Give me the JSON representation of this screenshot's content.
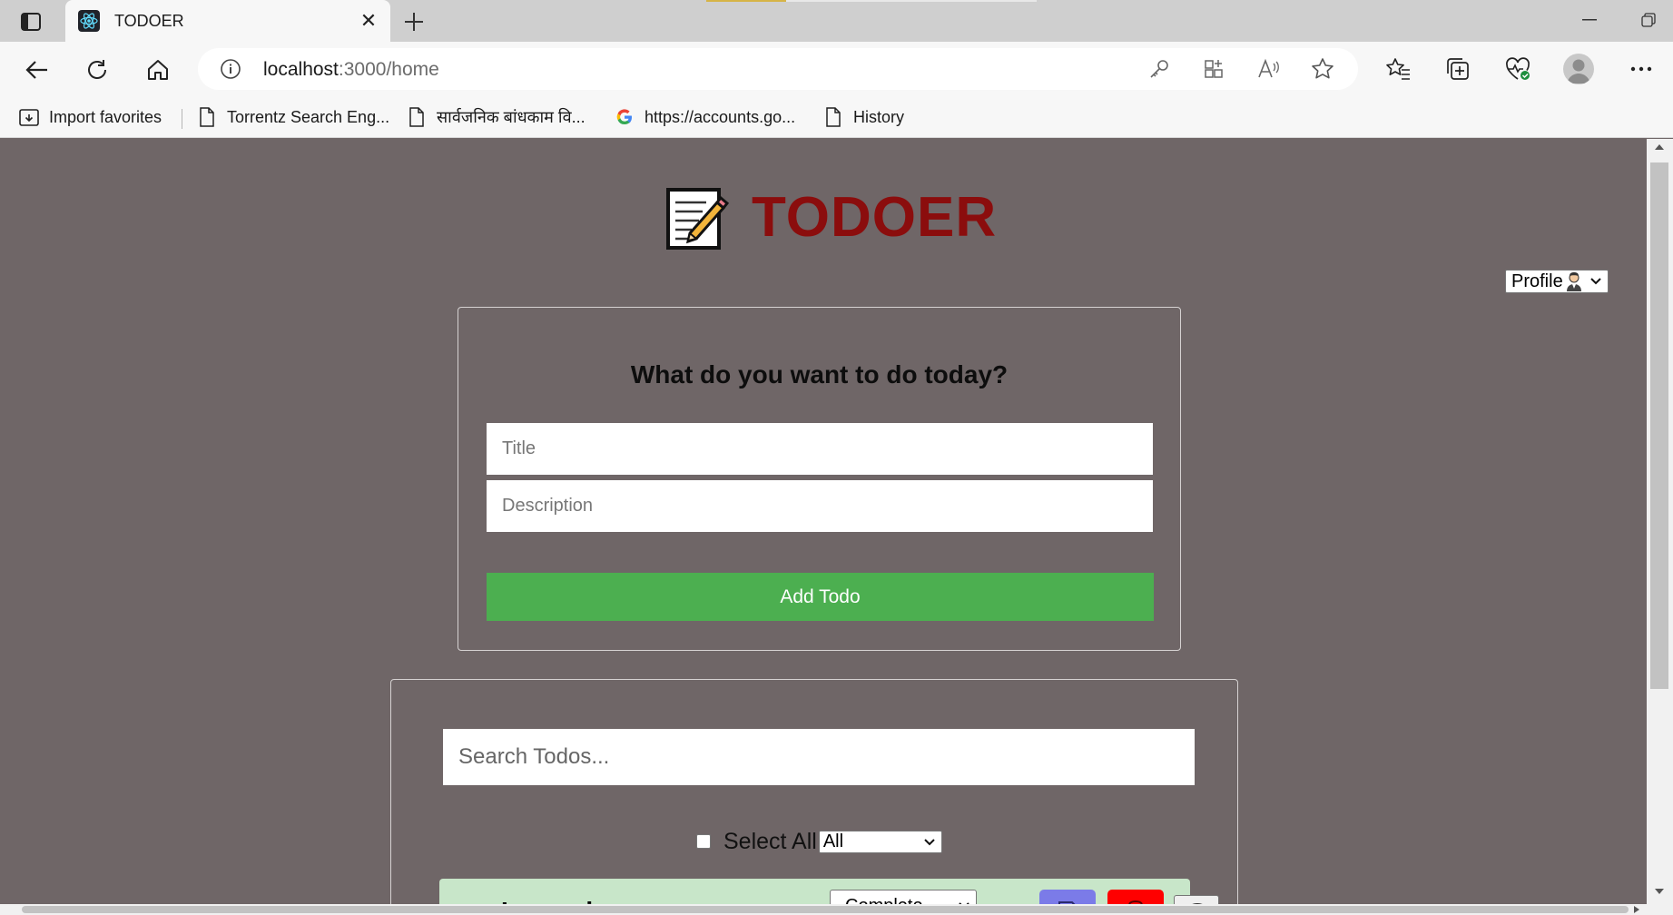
{
  "browser": {
    "tab_title": "TODOER",
    "url_host": "localhost",
    "url_path": ":3000/home",
    "bookmarks": [
      {
        "label": "Import favorites",
        "icon": "import-favorites-icon"
      },
      {
        "label": "Torrentz Search Eng...",
        "icon": "page-icon"
      },
      {
        "label": "सार्वजनिक बांधकाम वि...",
        "icon": "page-icon"
      },
      {
        "label": "https://accounts.go...",
        "icon": "google-icon"
      },
      {
        "label": "History",
        "icon": "page-icon"
      }
    ]
  },
  "app": {
    "title": "TODOER",
    "logo_icon": "memo-icon",
    "profile_label": "Profile"
  },
  "add_form": {
    "heading": "What do you want to do today?",
    "title_placeholder": "Title",
    "description_placeholder": "Description",
    "add_button": "Add Todo"
  },
  "list": {
    "search_placeholder": "Search Todos...",
    "select_all_label": "Select All",
    "filter_value": "All",
    "items": [
      {
        "title": "Lorem ipsum",
        "status": "Complete",
        "bg": "#c8e6c9"
      }
    ]
  },
  "colors": {
    "page_bg": "#6f6667",
    "title_red": "#8b0d0d",
    "add_green": "#4caf50",
    "edit_purple": "#7b7be8",
    "delete_red": "#ff0000"
  }
}
